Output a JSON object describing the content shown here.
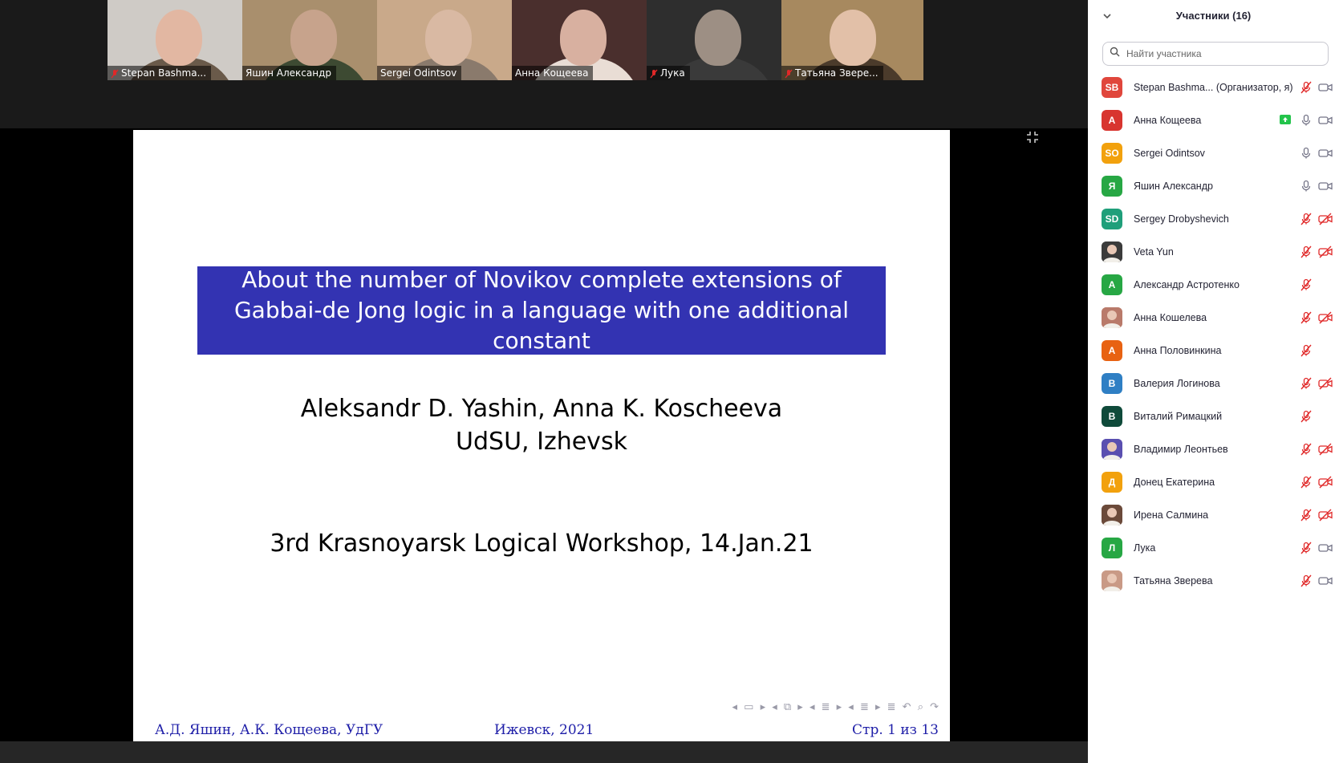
{
  "video_tiles": [
    {
      "name": "Stepan Bashma...",
      "muted": true,
      "bg": "#cfcbc6",
      "skin": "#e2b7a2",
      "shirt": "#6a5a4a"
    },
    {
      "name": "Яшин Александр",
      "muted": false,
      "bg": "#a98f6d",
      "skin": "#c7a38c",
      "shirt": "#3d4a32"
    },
    {
      "name": "Sergei Odintsov",
      "muted": false,
      "bg": "#c9a98a",
      "skin": "#d9b9a3",
      "shirt": "#8a7a6c"
    },
    {
      "name": "Анна Кощеева",
      "muted": false,
      "bg": "#4a2f2d",
      "skin": "#d8b0a0",
      "shirt": "#e9ddd5"
    },
    {
      "name": "Лука",
      "muted": true,
      "bg": "#2e2e2e",
      "skin": "#9d8f84",
      "shirt": "#3a3a3a"
    },
    {
      "name": "Татьяна Звере...",
      "muted": true,
      "bg": "#a7895f",
      "skin": "#e2c0a8",
      "shirt": "#4b3b2b"
    }
  ],
  "slide": {
    "title": "About the number of Novikov complete extensions of Gabbai-de Jong logic in a language with one additional constant",
    "authors": "Aleksandr D. Yashin, Anna K. Koscheeva",
    "affiliation": "UdSU, Izhevsk",
    "event": "3rd Krasnoyarsk Logical Workshop, 14.Jan.21",
    "footer_left": "А.Д. Яшин, А.К. Кощеева, УдГУ",
    "footer_center": "Ижевск, 2021",
    "footer_right": "Стр. 1 из 13",
    "nav_symbols": "◂ ▭ ▸  ◂ ⧉ ▸  ◂ ≣ ▸  ◂ ≣ ▸    ≣    ↶ ⌕ ↷",
    "title_color": "#3333b2",
    "footer_color": "#1e1ea8"
  },
  "panel": {
    "title": "Участники (16)",
    "search_placeholder": "Найти участника"
  },
  "participants": [
    {
      "initials": "SB",
      "name": "Stepan Bashma... (Организатор, я)",
      "color": "#e0463c",
      "photo": false,
      "share": false,
      "mic": "muted",
      "cam": "on"
    },
    {
      "initials": "А",
      "name": "Анна Кощеева",
      "color": "#d8352f",
      "photo": false,
      "share": true,
      "mic": "on",
      "cam": "on"
    },
    {
      "initials": "SO",
      "name": "Sergei Odintsov",
      "color": "#f2a10d",
      "photo": false,
      "share": false,
      "mic": "on",
      "cam": "on"
    },
    {
      "initials": "Я",
      "name": "Яшин Александр",
      "color": "#27a744",
      "photo": false,
      "share": false,
      "mic": "on",
      "cam": "on"
    },
    {
      "initials": "SD",
      "name": "Sergey Drobyshevich",
      "color": "#1f9f7a",
      "photo": false,
      "share": false,
      "mic": "muted",
      "cam": "off"
    },
    {
      "initials": "",
      "name": "Veta Yun",
      "color": "#3b3b3b",
      "photo": true,
      "share": false,
      "mic": "muted",
      "cam": "off"
    },
    {
      "initials": "А",
      "name": "Александр Астротенко",
      "color": "#27a744",
      "photo": false,
      "share": false,
      "mic": "muted",
      "cam": "none"
    },
    {
      "initials": "",
      "name": "Анна Кошелева",
      "color": "#b97a6a",
      "photo": true,
      "share": false,
      "mic": "muted",
      "cam": "off"
    },
    {
      "initials": "А",
      "name": "Анна Половинкина",
      "color": "#e86212",
      "photo": false,
      "share": false,
      "mic": "muted",
      "cam": "none"
    },
    {
      "initials": "В",
      "name": "Валерия Логинова",
      "color": "#2f7fc4",
      "photo": false,
      "share": false,
      "mic": "muted",
      "cam": "off"
    },
    {
      "initials": "В",
      "name": "Виталий Римацкий",
      "color": "#0f4a3a",
      "photo": false,
      "share": false,
      "mic": "muted",
      "cam": "none"
    },
    {
      "initials": "",
      "name": "Владимир Леонтьев",
      "color": "#5a4fb0",
      "photo": true,
      "share": false,
      "mic": "muted",
      "cam": "off"
    },
    {
      "initials": "Д",
      "name": "Донец Екатерина",
      "color": "#f2a10d",
      "photo": false,
      "share": false,
      "mic": "muted",
      "cam": "off"
    },
    {
      "initials": "",
      "name": "Ирена Салмина",
      "color": "#6b4a3a",
      "photo": true,
      "share": false,
      "mic": "muted",
      "cam": "off"
    },
    {
      "initials": "Л",
      "name": "Лука",
      "color": "#27a744",
      "photo": false,
      "share": false,
      "mic": "muted",
      "cam": "on"
    },
    {
      "initials": "",
      "name": "Татьяна Зверева",
      "color": "#c99a86",
      "photo": true,
      "share": false,
      "mic": "muted",
      "cam": "on"
    }
  ]
}
